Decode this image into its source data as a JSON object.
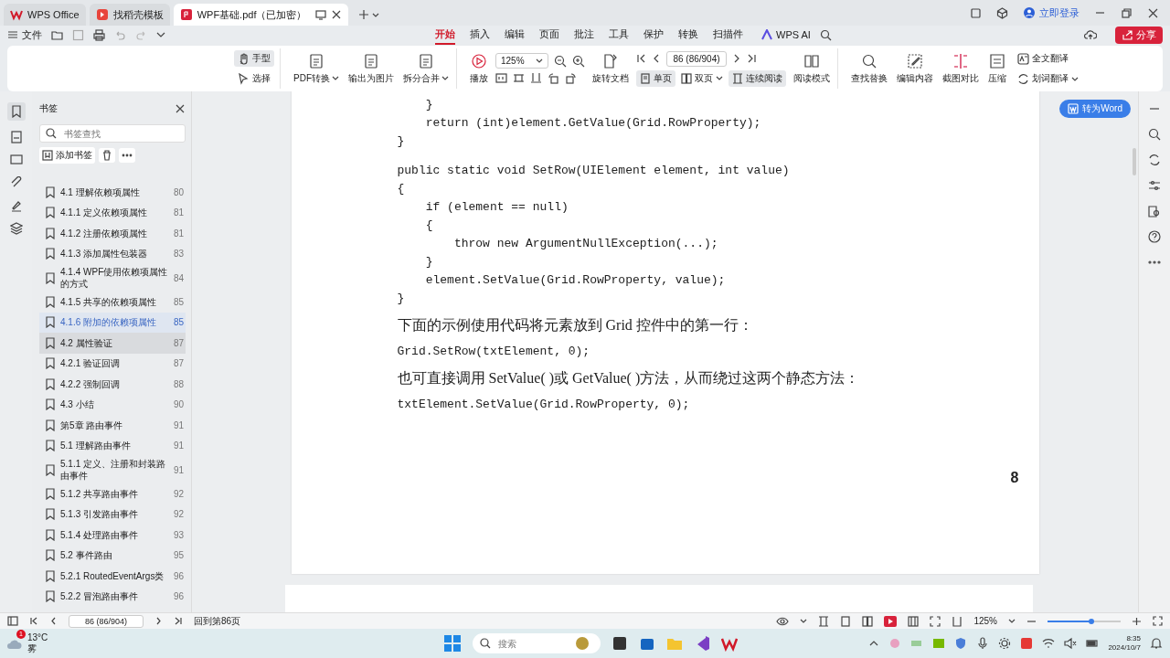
{
  "tabs": [
    {
      "kind": "home",
      "label": "WPS Office",
      "selected": false
    },
    {
      "kind": "template",
      "label": "找稻壳模板",
      "selected": false
    },
    {
      "kind": "pdf",
      "label": "WPF基础.pdf（已加密）",
      "selected": true
    }
  ],
  "account": {
    "login": "立即登录"
  },
  "menu": {
    "file": "文件",
    "tabs": [
      {
        "label": "开始",
        "selected": true
      },
      {
        "label": "插入",
        "selected": false
      },
      {
        "label": "编辑",
        "selected": false
      },
      {
        "label": "页面",
        "selected": false
      },
      {
        "label": "批注",
        "selected": false
      },
      {
        "label": "工具",
        "selected": false
      },
      {
        "label": "保护",
        "selected": false
      },
      {
        "label": "转换",
        "selected": false
      },
      {
        "label": "扫描件",
        "selected": false
      }
    ],
    "ai": "WPS AI",
    "share": "分享"
  },
  "toolbar": {
    "cursor_tools": [
      {
        "label": "手型",
        "selected": true
      },
      {
        "label": "选择",
        "selected": false
      }
    ],
    "convert": [
      {
        "label": "PDF转换",
        "dropdown": true
      },
      {
        "label": "输出为图片",
        "dropdown": false
      },
      {
        "label": "拆分合并",
        "dropdown": true
      }
    ],
    "play": "播放",
    "zoom": "125%",
    "rotate": "旋转文档",
    "page": "86 (86/904)",
    "layouts": [
      {
        "label": "单页",
        "selected": true,
        "dropdown": false
      },
      {
        "label": "双页",
        "selected": false,
        "dropdown": true
      },
      {
        "label": "连续阅读",
        "selected": true,
        "dropdown": false
      }
    ],
    "read_mode": "阅读模式",
    "tools": [
      "查找替换",
      "编辑内容",
      "截图对比",
      "压缩"
    ],
    "translate": [
      {
        "label": "全文翻译",
        "dropdown": false
      },
      {
        "label": "划词翻译",
        "dropdown": true
      }
    ]
  },
  "bookmarks": {
    "title": "书签",
    "placeholder": "书签查找",
    "add": "添加书签",
    "items": [
      {
        "label": "4.1 理解依赖项属性",
        "page": "80",
        "selected": false,
        "hovered": false
      },
      {
        "label": "4.1.1 定义依赖项属性",
        "page": "81",
        "selected": false,
        "hovered": false
      },
      {
        "label": "4.1.2 注册依赖项属性",
        "page": "81",
        "selected": false,
        "hovered": false
      },
      {
        "label": "4.1.3 添加属性包装器",
        "page": "83",
        "selected": false,
        "hovered": false
      },
      {
        "label": "4.1.4 WPF使用依赖项属性的方式",
        "page": "84",
        "selected": false,
        "hovered": false
      },
      {
        "label": "4.1.5 共享的依赖项属性",
        "page": "85",
        "selected": false,
        "hovered": false
      },
      {
        "label": "4.1.6 附加的依赖项属性",
        "page": "85",
        "selected": true,
        "hovered": false
      },
      {
        "label": "4.2 属性验证",
        "page": "87",
        "selected": false,
        "hovered": true
      },
      {
        "label": "4.2.1 验证回调",
        "page": "87",
        "selected": false,
        "hovered": false
      },
      {
        "label": "4.2.2 强制回调",
        "page": "88",
        "selected": false,
        "hovered": false
      },
      {
        "label": "4.3 小结",
        "page": "90",
        "selected": false,
        "hovered": false
      },
      {
        "label": "第5章 路由事件",
        "page": "91",
        "selected": false,
        "hovered": false
      },
      {
        "label": "5.1 理解路由事件",
        "page": "91",
        "selected": false,
        "hovered": false
      },
      {
        "label": "5.1.1 定义、注册和封装路由事件",
        "page": "91",
        "selected": false,
        "hovered": false
      },
      {
        "label": "5.1.2 共享路由事件",
        "page": "92",
        "selected": false,
        "hovered": false
      },
      {
        "label": "5.1.3 引发路由事件",
        "page": "92",
        "selected": false,
        "hovered": false
      },
      {
        "label": "5.1.4 处理路由事件",
        "page": "93",
        "selected": false,
        "hovered": false
      },
      {
        "label": "5.2 事件路由",
        "page": "95",
        "selected": false,
        "hovered": false
      },
      {
        "label": "5.2.1 RoutedEventArgs类",
        "page": "96",
        "selected": false,
        "hovered": false
      },
      {
        "label": "5.2.2 冒泡路由事件",
        "page": "96",
        "selected": false,
        "hovered": false
      }
    ]
  },
  "document": {
    "convert_button": "转为Word",
    "blocks": [
      {
        "kind": "code",
        "lines": [
          "    }",
          "    return (int)element.GetValue(Grid.RowProperty);",
          "}"
        ]
      },
      {
        "kind": "code",
        "lines": [
          "public static void SetRow(UIElement element, int value)",
          "{",
          "    if (element == null)",
          "    {",
          "        throw new ArgumentNullException(...);",
          "    }",
          "    element.SetValue(Grid.RowProperty, value);",
          "}"
        ]
      },
      {
        "kind": "text",
        "text": "下面的示例使用代码将元素放到 Grid 控件中的第一行："
      },
      {
        "kind": "code",
        "lines": [
          "Grid.SetRow(txtElement, 0);"
        ]
      },
      {
        "kind": "text",
        "text": "也可直接调用 SetValue( )或 GetValue( )方法，从而绕过这两个静态方法："
      },
      {
        "kind": "code",
        "lines": [
          "txtElement.SetValue(Grid.RowProperty, 0);"
        ]
      }
    ],
    "page_number": "8"
  },
  "status_bar": {
    "page": "86 (86/904)",
    "back": "回到第86页",
    "zoom": "125%",
    "zoom_slider": {
      "level": 0.6
    }
  },
  "taskbar": {
    "weather": {
      "temp": "13°C",
      "condition": "雾",
      "badge": "1"
    },
    "search": {
      "placeholder": "搜索"
    },
    "time": "8:35",
    "date": "2024/10/7"
  }
}
